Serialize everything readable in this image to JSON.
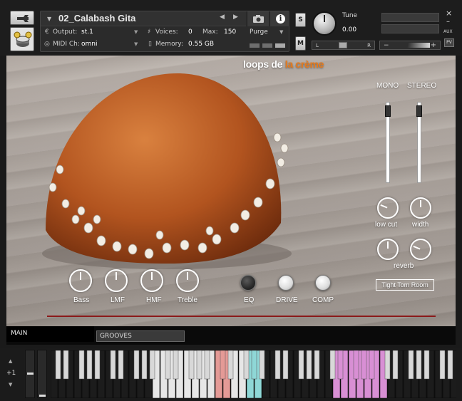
{
  "header": {
    "instrument_name": "02_Calabash Gita",
    "output_label": "Output:",
    "output_value": "st.1",
    "voices_label": "Voices:",
    "voices_value": "0",
    "max_label": "Max:",
    "max_value": "150",
    "purge_label": "Purge",
    "midi_label": "MIDI Ch:",
    "midi_value": "omni",
    "memory_label": "Memory:",
    "memory_value": "0.55 GB",
    "solo_label": "S",
    "mute_label": "M",
    "tune_label": "Tune",
    "tune_value": "0.00",
    "pan_left": "L",
    "pan_right": "R",
    "vol_minus": "−",
    "vol_plus": "+",
    "aux_label": "AUX",
    "pv_label": "PV",
    "close": "×",
    "minimize": "–",
    "prev": "◀",
    "next": "▶",
    "dropdown_arrow": "▼"
  },
  "brand": {
    "part1": "loops de ",
    "part2": "la crème"
  },
  "mixer": {
    "mono_label": "MONO",
    "stereo_label": "STEREO",
    "mono_level": 0.9,
    "stereo_level": 0.9
  },
  "eq_knobs": [
    {
      "label": "Bass",
      "value": 0.5
    },
    {
      "label": "LMF",
      "value": 0.5
    },
    {
      "label": "HMF",
      "value": 0.5
    },
    {
      "label": "Treble",
      "value": 0.5
    }
  ],
  "toggles": [
    {
      "label": "EQ",
      "on": true
    },
    {
      "label": "DRIVE",
      "on": false
    },
    {
      "label": "COMP",
      "on": false
    }
  ],
  "stereo_knobs": [
    {
      "label": "low cut",
      "value": 0.25
    },
    {
      "label": "width",
      "value": 0.5
    }
  ],
  "reverb": {
    "label": "reverb",
    "knob1": 0.5,
    "knob2": 0.25,
    "room": "Tight Tom Room"
  },
  "tabs": {
    "main": "MAIN",
    "grooves": "GROOVES"
  },
  "keyboard": {
    "octave_label": "+1",
    "octave_up": "▲",
    "octave_down": "▼"
  },
  "colors": {
    "accent_orange": "#e87a1a",
    "key_red": "#e49a96",
    "key_cyan": "#8ed7d6",
    "key_magenta": "#d88fd4",
    "key_white_lit": "#e6e6e6"
  }
}
